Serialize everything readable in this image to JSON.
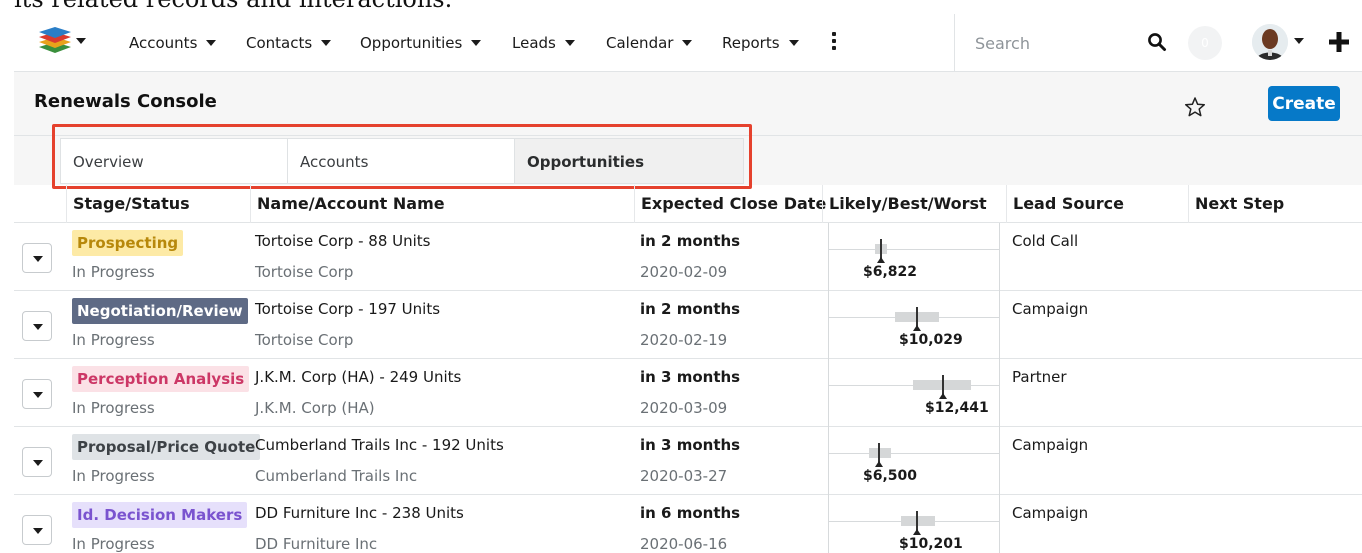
{
  "caption": "its related records and interactions.",
  "nav": {
    "items": [
      "Accounts",
      "Contacts",
      "Opportunities",
      "Leads",
      "Calendar",
      "Reports"
    ],
    "search_placeholder": "Search",
    "notification_count": "0"
  },
  "header": {
    "title": "Renewals Console",
    "create_label": "Create"
  },
  "tabs": [
    {
      "label": "Overview"
    },
    {
      "label": "Accounts"
    },
    {
      "label": "Opportunities"
    }
  ],
  "active_tab": "Opportunities",
  "columns": [
    "Stage/Status",
    "Name/Account Name",
    "Expected Close Date",
    "Likely/Best/Worst",
    "Lead Source",
    "Next Step"
  ],
  "rows": [
    {
      "stage": "Prospecting",
      "status": "In Progress",
      "name": "Tortoise Corp - 88 Units",
      "account": "Tortoise Corp",
      "close_relative": "in 2 months",
      "close_date": "2020-02-09",
      "likely": "$6,822",
      "lead_source": "Cold Call",
      "next_step": ""
    },
    {
      "stage": "Negotiation/Review",
      "status": "In Progress",
      "name": "Tortoise Corp - 197 Units",
      "account": "Tortoise Corp",
      "close_relative": "in 2 months",
      "close_date": "2020-02-19",
      "likely": "$10,029",
      "lead_source": "Campaign",
      "next_step": ""
    },
    {
      "stage": "Perception Analysis",
      "status": "In Progress",
      "name": "J.K.M. Corp (HA) - 249 Units",
      "account": "J.K.M. Corp (HA)",
      "close_relative": "in 3 months",
      "close_date": "2020-03-09",
      "likely": "$12,441",
      "lead_source": "Partner",
      "next_step": ""
    },
    {
      "stage": "Proposal/Price Quote",
      "status": "In Progress",
      "name": "Cumberland Trails Inc - 192 Units",
      "account": "Cumberland Trails Inc",
      "close_relative": "in 3 months",
      "close_date": "2020-03-27",
      "likely": "$6,500",
      "lead_source": "Campaign",
      "next_step": ""
    },
    {
      "stage": "Id. Decision Makers",
      "status": "In Progress",
      "name": "DD Furniture Inc - 238 Units",
      "account": "DD Furniture Inc",
      "close_relative": "in 6 months",
      "close_date": "2020-06-16",
      "likely": "$10,201",
      "lead_source": "Campaign",
      "next_step": ""
    }
  ],
  "stage_colors": {
    "Prospecting": {
      "bg": "#fdeaa6",
      "fg": "#b7880b"
    },
    "Negotiation/Review": {
      "bg": "#5e6a85",
      "fg": "#ffffff"
    },
    "Perception Analysis": {
      "bg": "#fbe1e6",
      "fg": "#cc3766"
    },
    "Proposal/Price Quote": {
      "bg": "#dfe3e6",
      "fg": "#3d4246"
    },
    "Id. Decision Makers": {
      "bg": "#e6e0fb",
      "fg": "#7a53cf"
    }
  },
  "icons": {
    "logo": "layered-stack-logo",
    "more": "vertical-ellipsis-icon",
    "search": "search-icon",
    "favorite": "star-outline-icon",
    "add": "plus-icon",
    "row_action": "caret-down-icon"
  }
}
